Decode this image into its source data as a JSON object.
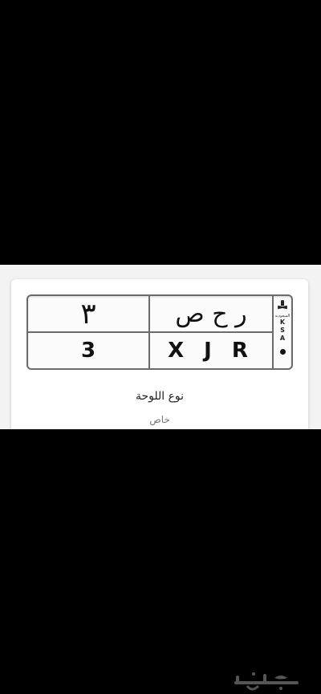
{
  "plate": {
    "number_arabic": "٣",
    "letters_arabic": "ر ح ص",
    "number_english": "3",
    "letters_english": "X J R",
    "country_code": [
      "K",
      "S",
      "A"
    ],
    "emblem_text": "السعودية"
  },
  "details": {
    "type_label": "نوع اللوحة",
    "type_value": "خاص"
  },
  "watermark": {
    "text": "حراج"
  }
}
